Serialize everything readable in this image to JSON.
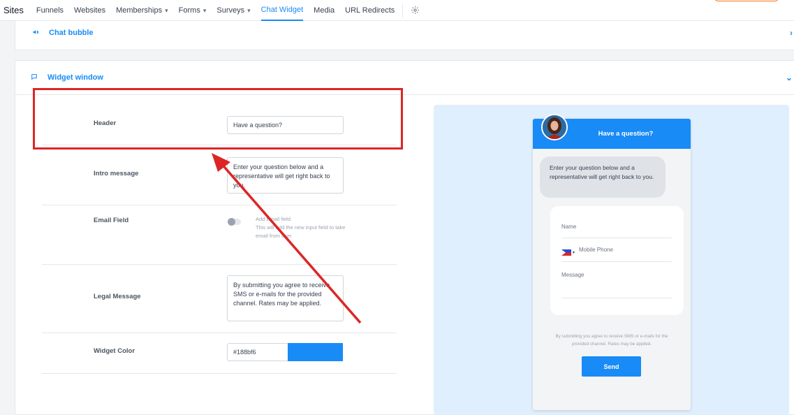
{
  "nav": {
    "brand": "Sites",
    "items": [
      {
        "label": "Funnels",
        "dropdown": false,
        "active": false
      },
      {
        "label": "Websites",
        "dropdown": false,
        "active": false
      },
      {
        "label": "Memberships",
        "dropdown": true,
        "active": false
      },
      {
        "label": "Forms",
        "dropdown": true,
        "active": false
      },
      {
        "label": "Surveys",
        "dropdown": true,
        "active": false
      },
      {
        "label": "Chat Widget",
        "dropdown": false,
        "active": true
      },
      {
        "label": "Media",
        "dropdown": false,
        "active": false
      },
      {
        "label": "URL Redirects",
        "dropdown": false,
        "active": false
      }
    ],
    "settings_icon": "gear-icon"
  },
  "chat_bubble_section": {
    "title": "Chat bubble",
    "icon": "megaphone-icon",
    "expand_icon": "chevron-right-icon"
  },
  "widget_window_section": {
    "title": "Widget window",
    "icon": "chat-icon",
    "expand_icon": "chevron-down-icon",
    "header": {
      "label": "Header",
      "value": "Have a question?"
    },
    "intro": {
      "label": "Intro message",
      "value": "Enter your question below and a representative will get right back to you."
    },
    "email_field": {
      "label": "Email Field",
      "toggle_on": false,
      "toggle_title": "Add Email field",
      "toggle_desc": "This will add the new input field to take email from user"
    },
    "legal": {
      "label": "Legal Message",
      "value": "By submitting you agree to receive SMS or e-mails for the provided channel. Rates may be applied."
    },
    "color": {
      "label": "Widget Color",
      "value": "#188bf6"
    }
  },
  "preview": {
    "header_title": "Have a question?",
    "intro": "Enter your question below and a representative will get right back to you.",
    "fields": {
      "name": "Name",
      "phone": "Mobile Phone",
      "message": "Message"
    },
    "legal": "By submitting you agree to receive SMS or e-mails for the provided channel. Rates may be applied.",
    "send_label": "Send"
  },
  "colors": {
    "accent": "#188bf6",
    "annotation": "#dc2626"
  }
}
